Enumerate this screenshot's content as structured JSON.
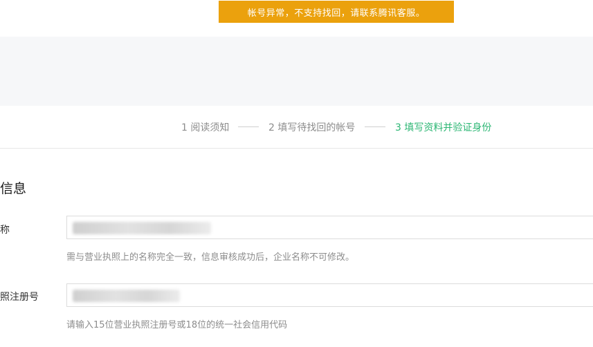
{
  "alert": {
    "text": "帐号异常，不支持找回，请联系腾讯客服。"
  },
  "steps": [
    {
      "label": "1 阅读须知"
    },
    {
      "label": "2 填写待找回的帐号"
    },
    {
      "label": "3 填写资料并验证身份"
    }
  ],
  "section": {
    "title": "信息"
  },
  "fields": {
    "company_name": {
      "label": "称",
      "hint": "需与营业执照上的名称完全一致，信息审核成功后，企业名称不可修改。"
    },
    "license_number": {
      "label": "照注册号",
      "hint": "请输入15位营业执照注册号或18位的统一社会信用代码"
    }
  },
  "colors": {
    "alert_bg": "#eba10d",
    "active_step": "#2bb673",
    "inactive_step": "#8c8c8c"
  }
}
